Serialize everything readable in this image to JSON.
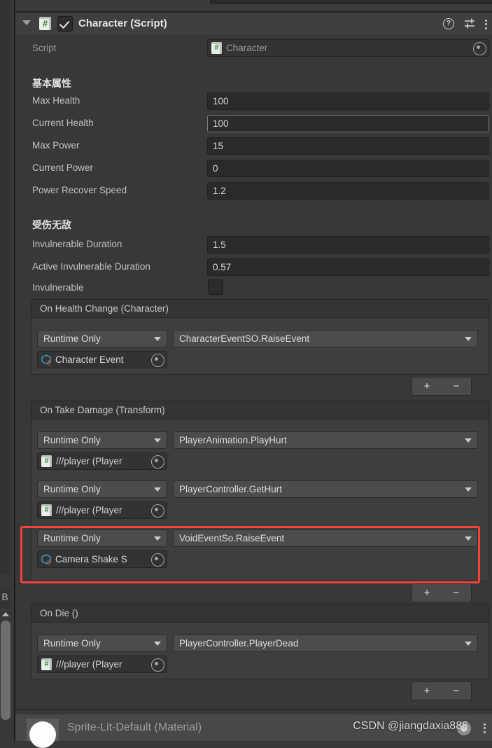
{
  "window": {
    "background": "#383838",
    "accent_red": "#f4433c",
    "gutter_glyph": "B"
  },
  "component": {
    "title": "Character (Script)",
    "enabled": true,
    "expanded": true,
    "icon": "csharp-script-icon",
    "tools": {
      "help": "?",
      "preset": "preset-icon",
      "menu": "more-menu-icon"
    }
  },
  "script_row": {
    "label": "Script",
    "value": "Character"
  },
  "sections": [
    {
      "header": "基本属性",
      "fields": [
        {
          "label": "Max Health",
          "value": "100",
          "focused": false
        },
        {
          "label": "Current Health",
          "value": "100",
          "focused": true
        },
        {
          "label": "Max Power",
          "value": "15",
          "focused": false
        },
        {
          "label": "Current Power",
          "value": "0",
          "focused": false
        },
        {
          "label": "Power Recover Speed",
          "value": "1.2",
          "focused": false
        }
      ]
    },
    {
      "header": "受伤无敌",
      "fields": [
        {
          "label": "Invulnerable Duration",
          "value": "1.5",
          "focused": false
        },
        {
          "label": "Active Invulnerable Duration",
          "value": "0.57",
          "focused": false
        }
      ],
      "toggle": {
        "label": "Invulnerable",
        "checked": false
      }
    }
  ],
  "events": [
    {
      "title": "On Health Change (Character)",
      "entries": [
        {
          "mode": "Runtime Only",
          "method": "CharacterEventSO.RaiseEvent",
          "target": "Character Event",
          "target_icon": "scriptable-object-icon"
        }
      ],
      "add": "+",
      "remove": "−"
    },
    {
      "title": "On Take Damage (Transform)",
      "entries": [
        {
          "mode": "Runtime Only",
          "method": "PlayerAnimation.PlayHurt",
          "target": "///player (Player",
          "target_icon": "csharp-script-icon"
        },
        {
          "mode": "Runtime Only",
          "method": "PlayerController.GetHurt",
          "target": "///player (Player",
          "target_icon": "csharp-script-icon"
        },
        {
          "mode": "Runtime Only",
          "method": "VoidEventSo.RaiseEvent",
          "target": "Camera Shake S",
          "target_icon": "scriptable-object-icon",
          "highlighted": true
        }
      ],
      "add": "+",
      "remove": "−"
    },
    {
      "title": "On Die ()",
      "entries": [
        {
          "mode": "Runtime Only",
          "method": "PlayerController.PlayerDead",
          "target": "///player (Player",
          "target_icon": "csharp-script-icon"
        }
      ],
      "add": "+",
      "remove": "−"
    }
  ],
  "footer": {
    "title": "Sprite-Lit-Default (Material)",
    "menu": "more-menu-icon"
  },
  "watermark": {
    "text": "CSDN @jiangdaxia886"
  }
}
